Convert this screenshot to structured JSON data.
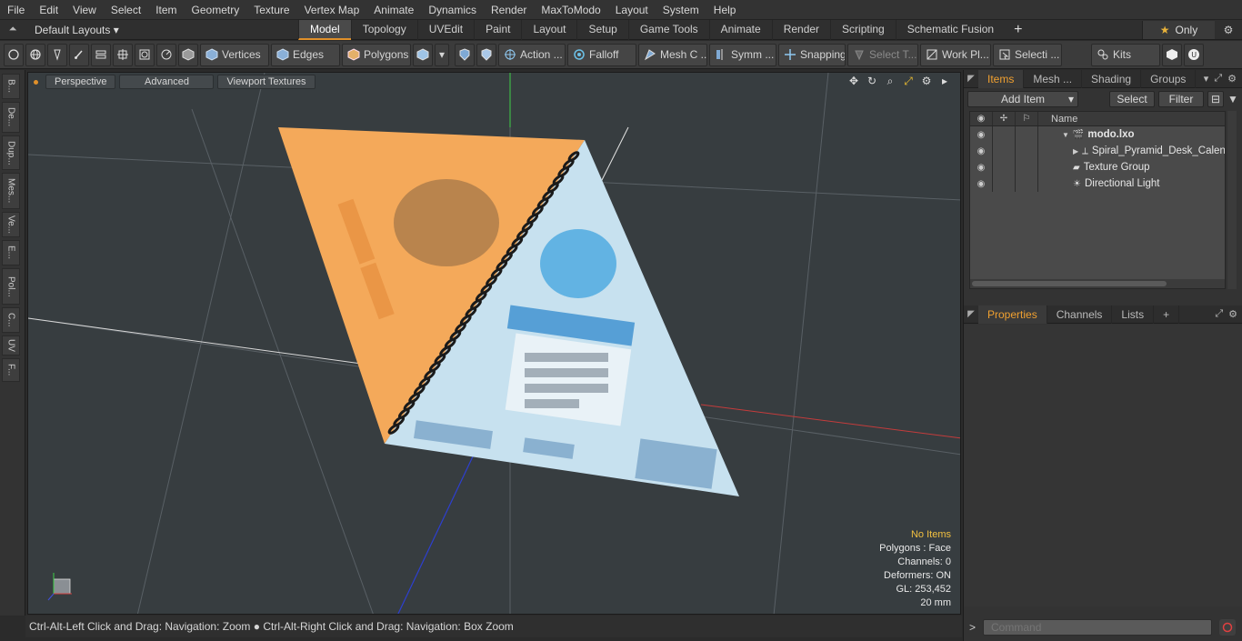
{
  "menubar": [
    "File",
    "Edit",
    "View",
    "Select",
    "Item",
    "Geometry",
    "Texture",
    "Vertex Map",
    "Animate",
    "Dynamics",
    "Render",
    "MaxToModo",
    "Layout",
    "System",
    "Help"
  ],
  "layoutbar": {
    "layout_select": "Default Layouts ▾",
    "tabs": [
      "Model",
      "Topology",
      "UVEdit",
      "Paint",
      "Layout",
      "Setup",
      "Game Tools",
      "Animate",
      "Render",
      "Scripting",
      "Schematic Fusion"
    ],
    "active_tab": "Model",
    "only_label": "Only"
  },
  "toolbar": {
    "vertices": "Vertices",
    "edges": "Edges",
    "polygons": "Polygons",
    "action": "Action ...",
    "falloff": "Falloff",
    "mesh": "Mesh C ...",
    "symm": "Symm ...",
    "snapping": "Snapping",
    "select_t": "Select T...",
    "work_pl": "Work Pl...",
    "selecti": "Selecti ...",
    "kits": "Kits"
  },
  "leftstrip": [
    "B...",
    "De...",
    "Dup...",
    "Mes...",
    "Ve...",
    "E...",
    "Pol...",
    "C...",
    "UV",
    "F..."
  ],
  "viewport": {
    "tabs": [
      "Perspective",
      "Advanced",
      "Viewport Textures"
    ],
    "info": {
      "selection": "No Items",
      "polygons": "Polygons : Face",
      "channels": "Channels: 0",
      "deformers": "Deformers: ON",
      "gl": "GL: 253,452",
      "scale": "20 mm"
    },
    "colors": {
      "background": "#373d40",
      "orange_face": "#f4a95a",
      "blue_face": "#c7e1ef",
      "y_axis": "#3fd048",
      "x_axis": "#c43c3c",
      "z_axis": "#2d3fd0"
    }
  },
  "statusbar": {
    "hint1": "Ctrl-Alt-Left Click and Drag: Navigation: Zoom",
    "hint2": "Ctrl-Alt-Right Click and Drag: Navigation: Box Zoom"
  },
  "items_panel": {
    "tabs": [
      "Items",
      "Mesh ...",
      "Shading",
      "Groups"
    ],
    "active": "Items",
    "add_item": "Add Item",
    "select": "Select",
    "filter": "Filter",
    "col_name": "Name",
    "rows": [
      {
        "name": "modo.lxo"
      },
      {
        "name": "Spiral_Pyramid_Desk_Calend ..."
      },
      {
        "name": "Texture Group"
      },
      {
        "name": "Directional Light"
      }
    ]
  },
  "props_panel": {
    "tabs": [
      "Properties",
      "Channels",
      "Lists"
    ],
    "active": "Properties"
  },
  "command": {
    "placeholder": "Command"
  }
}
